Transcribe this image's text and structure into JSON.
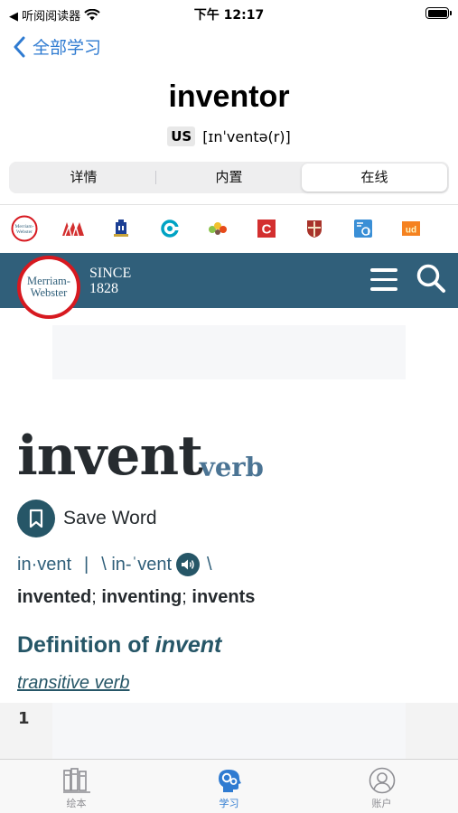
{
  "status_bar": {
    "back_app": "◀ 听阅阅读器",
    "time": "下午 12:17"
  },
  "nav": {
    "back_label": "全部学习"
  },
  "word": {
    "title": "inventor",
    "region": "US",
    "phonetic": "[ɪnˈventə(r)]"
  },
  "segments": [
    {
      "label": "详情",
      "active": false
    },
    {
      "label": "内置",
      "active": false
    },
    {
      "label": "在线",
      "active": true
    }
  ],
  "dictionaries": [
    {
      "icon": "merriam-webster-icon",
      "text": "Merriam-Webster",
      "color": "#d71920"
    },
    {
      "icon": "macmillan-icon",
      "color": "#d32f2f"
    },
    {
      "icon": "oxford-icon",
      "color": "#1c3f94"
    },
    {
      "icon": "collins-icon",
      "color": "#00a3c4"
    },
    {
      "icon": "wordnik-icon",
      "color": "#8bc34a"
    },
    {
      "icon": "cambridge-c-icon",
      "color": "#d32f2f"
    },
    {
      "icon": "cambridge-shield-icon",
      "color": "#a8332a"
    },
    {
      "icon": "dictionary-com-icon",
      "color": "#3a8fd6"
    },
    {
      "icon": "urban-dictionary-icon",
      "text": "ud",
      "color": "#f58220"
    }
  ],
  "mw_page": {
    "logo_line1": "Merriam-",
    "logo_line2": "Webster",
    "since_line1": "SINCE",
    "since_line2": "1828",
    "headword": "invent",
    "part_of_speech": "verb",
    "save_label": "Save Word",
    "syllables": "in·vent",
    "separator": "|",
    "pron_open": "\\ in-ˈvent",
    "pron_close": "\\",
    "forms": [
      {
        "word": "invented",
        "sep": "; "
      },
      {
        "word": "inventing",
        "sep": "; "
      },
      {
        "word": "invents",
        "sep": ""
      }
    ],
    "definition_prefix": "Definition of ",
    "definition_word": "invent",
    "pos_label": "transitive verb",
    "sense_number": "1"
  },
  "tabbar": [
    {
      "label": "绘本",
      "icon": "books-icon",
      "active": false
    },
    {
      "label": "学习",
      "icon": "brain-gears-icon",
      "active": true
    },
    {
      "label": "账户",
      "icon": "account-icon",
      "active": false
    }
  ],
  "colors": {
    "accent": "#2f7bd1",
    "mw_blue": "#305f7a",
    "mw_dark": "#265667",
    "mw_red": "#d71920"
  }
}
